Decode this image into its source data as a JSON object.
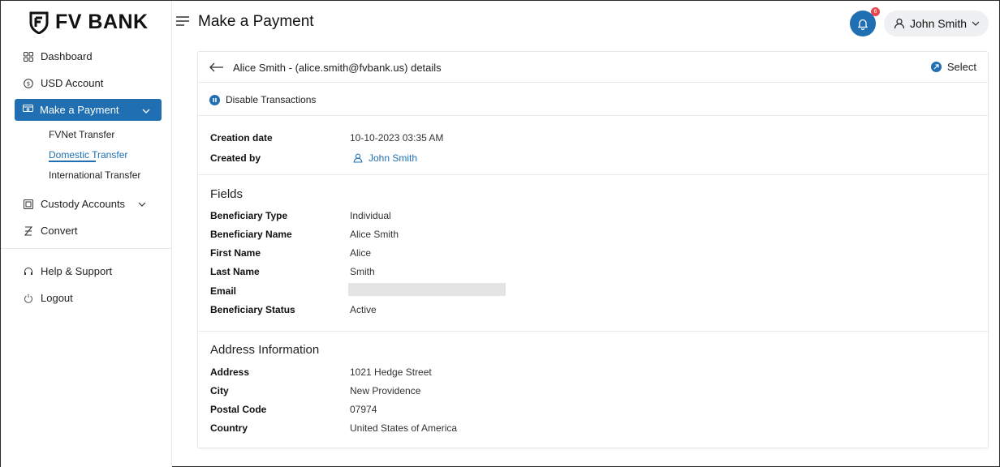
{
  "brand": {
    "name": "FV BANK"
  },
  "sidebar": {
    "items": [
      {
        "label": "Dashboard",
        "icon": "grid-icon"
      },
      {
        "label": "USD Account",
        "icon": "dollar-circle-icon"
      },
      {
        "label": "Make a Payment",
        "icon": "payment-icon",
        "active": true
      },
      {
        "label": "Custody Accounts",
        "icon": "custody-icon"
      },
      {
        "label": "Convert",
        "icon": "convert-icon"
      },
      {
        "label": "Help & Support",
        "icon": "headset-icon"
      },
      {
        "label": "Logout",
        "icon": "power-icon"
      }
    ],
    "payment_sub": [
      {
        "label": "FVNet Transfer"
      },
      {
        "label": "Domestic Transfer",
        "active": true
      },
      {
        "label": "International Transfer"
      }
    ]
  },
  "header": {
    "title": "Make a Payment",
    "notifications_count": "6",
    "user_name": "John Smith"
  },
  "detail": {
    "title": "Alice Smith - (alice.smith@fvbank.us) details",
    "select_label": "Select",
    "disable_label": "Disable Transactions",
    "meta": {
      "creation_date_label": "Creation date",
      "creation_date_value": "10-10-2023 03:35 AM",
      "created_by_label": "Created by",
      "created_by_value": "John Smith"
    },
    "fields": {
      "section_title": "Fields",
      "rows": [
        {
          "label": "Beneficiary Type",
          "value": "Individual"
        },
        {
          "label": "Beneficiary Name",
          "value": "Alice Smith"
        },
        {
          "label": "First Name",
          "value": "Alice"
        },
        {
          "label": "Last Name",
          "value": "Smith"
        },
        {
          "label": "Email",
          "value": ""
        },
        {
          "label": "Beneficiary Status",
          "value": "Active"
        }
      ]
    },
    "address": {
      "section_title": "Address Information",
      "rows": [
        {
          "label": "Address",
          "value": "1021 Hedge Street"
        },
        {
          "label": "City",
          "value": "New Providence"
        },
        {
          "label": "Postal Code",
          "value": "07974"
        },
        {
          "label": "Country",
          "value": "United States of America"
        }
      ]
    }
  },
  "colors": {
    "accent": "#1f6fb2",
    "badge": "#e5484d"
  }
}
